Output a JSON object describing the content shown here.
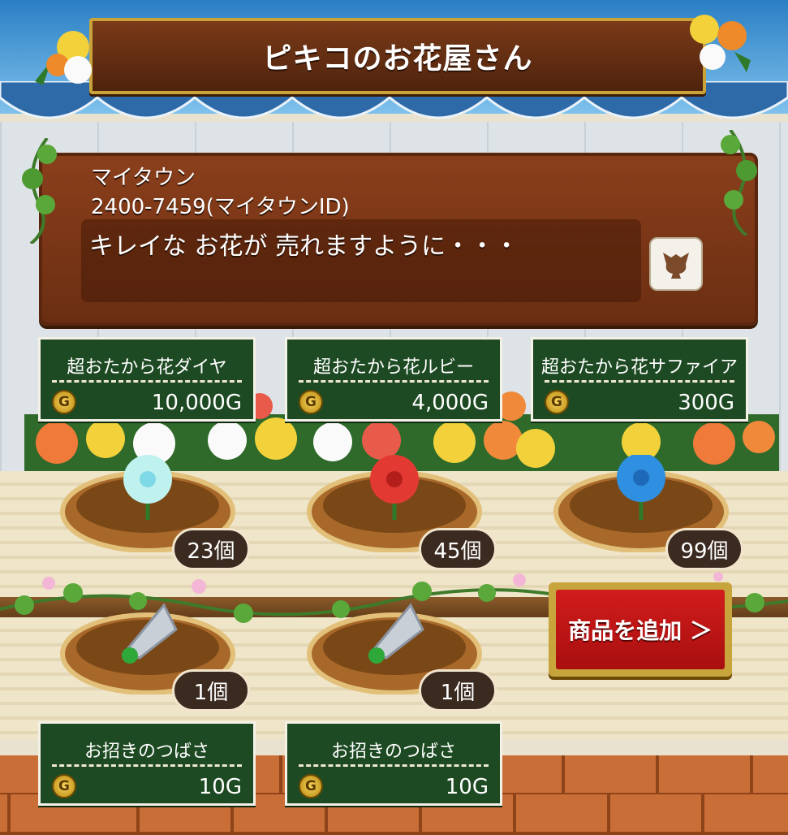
{
  "shop": {
    "title": "ピキコのお花屋さん",
    "town_name": "マイタウン",
    "town_id": "2400-7459(マイタウンID)",
    "message": "キレイな お花が 売れますように・・・",
    "emote_icon": "creature-silhouette-icon"
  },
  "items": [
    {
      "name": "超おたから花ダイヤ",
      "price": "10,000G",
      "count": "23個",
      "icon": "cyan-flower-icon",
      "color": "#bff2ee"
    },
    {
      "name": "超おたから花ルビー",
      "price": "4,000G",
      "count": "45個",
      "icon": "red-flower-icon",
      "color": "#e23a32"
    },
    {
      "name": "超おたから花サファイア",
      "price": "300G",
      "count": "99個",
      "icon": "blue-flower-icon",
      "color": "#2f8fe0"
    },
    {
      "name": "お招きのつばさ",
      "price": "10G",
      "count": "1個",
      "icon": "wing-icon",
      "color": "#c9cfd6"
    },
    {
      "name": "お招きのつばさ",
      "price": "10G",
      "count": "1個",
      "icon": "wing-icon",
      "color": "#c9cfd6"
    }
  ],
  "coin_symbol": "G",
  "add_button": {
    "label": "商品を追加 ＞"
  },
  "colors": {
    "label_bg": "#1e4a23",
    "sign_wood": "#7a3a18",
    "add_button": "#c8161a",
    "frame_gold": "#c9a33a"
  }
}
